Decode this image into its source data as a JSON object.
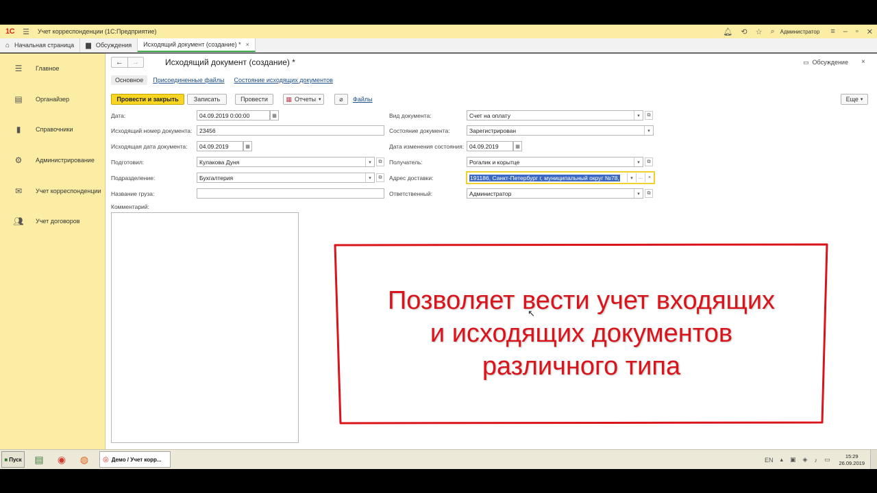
{
  "titlebar": {
    "logo": "1C",
    "title": "Учет корреспонденции  (1С:Предприятие)",
    "user": "Администратор",
    "icons": [
      "bell-icon",
      "history-icon",
      "star-icon",
      "search-icon",
      "settings-lines-icon",
      "minimize-icon",
      "restore-icon",
      "close-icon"
    ]
  },
  "tabs": [
    {
      "label": "Начальная страница",
      "icon": "home-icon"
    },
    {
      "label": "Обсуждения",
      "icon": "chat-icon"
    },
    {
      "label": "Исходящий документ (создание) *",
      "close": "×"
    }
  ],
  "sidebar": {
    "items": [
      {
        "label": "Главное",
        "icon": "menu-lines-icon"
      },
      {
        "label": "Органайзер",
        "icon": "notepad-icon"
      },
      {
        "label": "Справочники",
        "icon": "book-icon"
      },
      {
        "label": "Администрирование",
        "icon": "gear-icon"
      },
      {
        "label": "Учет корреспонденции",
        "icon": "envelope-wings-icon"
      },
      {
        "label": "Учет договоров",
        "icon": "people-icon"
      }
    ]
  },
  "doc": {
    "title": "Исходящий документ (создание) *",
    "discuss": "Обсуждение",
    "close": "×",
    "subtabs": [
      "Основное",
      "Присоединенные файлы",
      "Состояние исходящих документов"
    ]
  },
  "toolbar": {
    "post_close": "Провести и закрыть",
    "save": "Записать",
    "post": "Провести",
    "reports": "Отчеты",
    "files": "Файлы",
    "more": "Еще"
  },
  "form": {
    "date_label": "Дата:",
    "date_value": "04.09.2019  0:00:00",
    "out_num_label": "Исходящий номер документа:",
    "out_num_value": "23456",
    "out_date_label": "Исходящая дата документа:",
    "out_date_value": "04.09.2019",
    "prepared_label": "Подготовил:",
    "prepared_value": "Кулакова Дуня",
    "dept_label": "Подразделение:",
    "dept_value": "Бухгалтерия",
    "cargo_label": "Название груза:",
    "cargo_value": "",
    "comment_label": "Комментарий:",
    "doc_type_label": "Вид документа:",
    "doc_type_value": "Счет на оплату",
    "doc_state_label": "Состояние документа:",
    "doc_state_value": "Зарегистрирован",
    "state_date_label": "Дата изменения состояния:",
    "state_date_value": "04.09.2019",
    "recipient_label": "Получатель:",
    "recipient_value": "Рогалик и корытце",
    "address_label": "Адрес доставки:",
    "address_value": "191186, Санкт-Петербург г, муниципальный округ №78,",
    "responsible_label": "Ответственный:",
    "responsible_value": "Администратор"
  },
  "callout": {
    "line1": "Позволяет вести учет входящих",
    "line2": "и исходящих документов",
    "line3": "различного типа",
    "color": "#d9141b"
  },
  "taskbar": {
    "start": "Пуск",
    "task": "Демо / Учет корр...",
    "lang": "EN",
    "time": "15:29",
    "date": "26.09.2019"
  }
}
